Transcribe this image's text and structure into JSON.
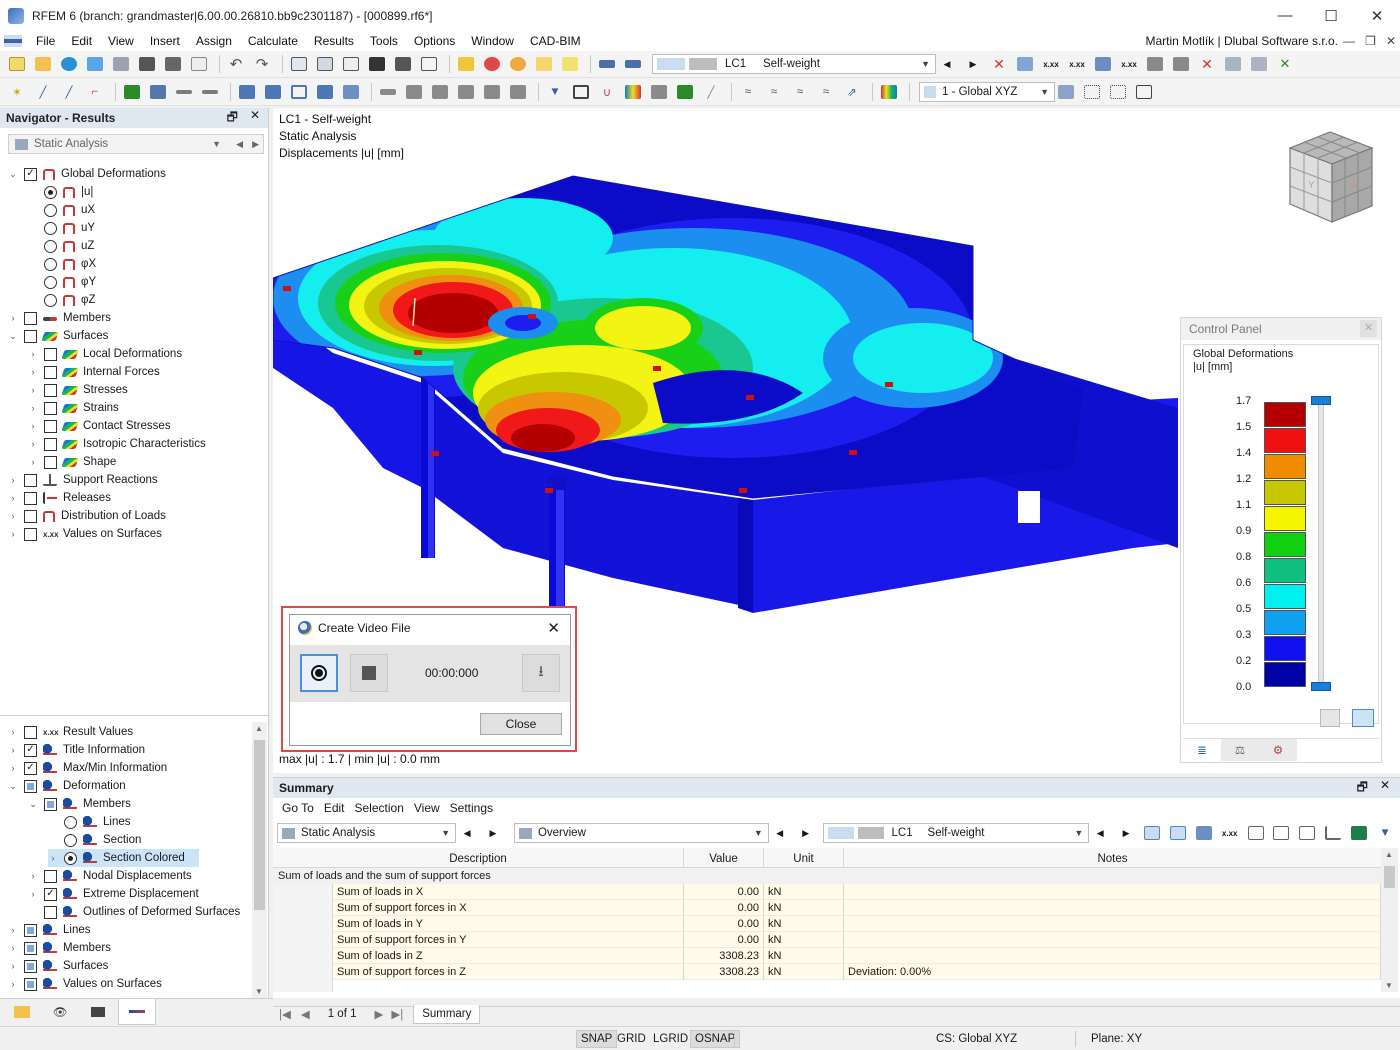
{
  "window": {
    "title": "RFEM 6 (branch: grandmaster|6.00.00.26810.bb9c2301187) - [000899.rf6*]",
    "minimize": "—",
    "maximize": "☐",
    "close": "✕"
  },
  "menu": {
    "items": [
      "File",
      "Edit",
      "View",
      "Insert",
      "Assign",
      "Calculate",
      "Results",
      "Tools",
      "Options",
      "Window",
      "CAD-BIM"
    ],
    "user": "Martin Motlík | Dlubal Software s.r.o."
  },
  "toolbar1": {
    "lc_code": "LC1",
    "lc_name": "Self-weight"
  },
  "toolbar2": {
    "coord_system": "1 - Global XYZ"
  },
  "navigator": {
    "title": "Navigator - Results",
    "selector": "Static Analysis",
    "top_tree": [
      {
        "label": "Global Deformations",
        "level": 0,
        "exp": "open",
        "check": "checked",
        "icon": "def"
      },
      {
        "label": "|u|",
        "level": 1,
        "radio": true,
        "on": true,
        "icon": "def"
      },
      {
        "label": "uX",
        "level": 1,
        "radio": true,
        "icon": "def"
      },
      {
        "label": "uY",
        "level": 1,
        "radio": true,
        "icon": "def"
      },
      {
        "label": "uZ",
        "level": 1,
        "radio": true,
        "icon": "def"
      },
      {
        "label": "φX",
        "level": 1,
        "radio": true,
        "icon": "def"
      },
      {
        "label": "φY",
        "level": 1,
        "radio": true,
        "icon": "def"
      },
      {
        "label": "φZ",
        "level": 1,
        "radio": true,
        "icon": "def"
      },
      {
        "label": "Members",
        "level": 0,
        "exp": "closed",
        "check": "empty",
        "icon": "mem"
      },
      {
        "label": "Surfaces",
        "level": 0,
        "exp": "open",
        "check": "empty",
        "icon": "surf"
      },
      {
        "label": "Local Deformations",
        "level": 1,
        "exp": "closed",
        "check": "empty",
        "icon": "surf"
      },
      {
        "label": "Internal Forces",
        "level": 1,
        "exp": "closed",
        "check": "empty",
        "icon": "surf"
      },
      {
        "label": "Stresses",
        "level": 1,
        "exp": "closed",
        "check": "empty",
        "icon": "surf"
      },
      {
        "label": "Strains",
        "level": 1,
        "exp": "closed",
        "check": "empty",
        "icon": "surf"
      },
      {
        "label": "Contact Stresses",
        "level": 1,
        "exp": "closed",
        "check": "empty",
        "icon": "surf"
      },
      {
        "label": "Isotropic Characteristics",
        "level": 1,
        "exp": "closed",
        "check": "empty",
        "icon": "surf"
      },
      {
        "label": "Shape",
        "level": 1,
        "exp": "closed",
        "check": "empty",
        "icon": "surf"
      },
      {
        "label": "Support Reactions",
        "level": 0,
        "exp": "closed",
        "check": "empty",
        "icon": "supp"
      },
      {
        "label": "Releases",
        "level": 0,
        "exp": "closed",
        "check": "empty",
        "icon": "rel"
      },
      {
        "label": "Distribution of Loads",
        "level": 0,
        "exp": "closed",
        "check": "empty",
        "icon": "def"
      },
      {
        "label": "Values on Surfaces",
        "level": 0,
        "exp": "closed",
        "check": "empty",
        "icon": "xxx"
      }
    ],
    "bottom_tree": [
      {
        "label": "Result Values",
        "level": 0,
        "exp": "closed",
        "check": "empty",
        "icon": "xxx"
      },
      {
        "label": "Title Information",
        "level": 0,
        "exp": "closed",
        "check": "checked",
        "icon": "disp"
      },
      {
        "label": "Max/Min Information",
        "level": 0,
        "exp": "closed",
        "check": "checked",
        "icon": "disp"
      },
      {
        "label": "Deformation",
        "level": 0,
        "exp": "open",
        "check": "partial",
        "icon": "disp"
      },
      {
        "label": "Members",
        "level": 1,
        "exp": "open",
        "check": "partial",
        "icon": "disp"
      },
      {
        "label": "Lines",
        "level": 2,
        "radio": true,
        "icon": "disp"
      },
      {
        "label": "Section",
        "level": 2,
        "radio": true,
        "icon": "disp"
      },
      {
        "label": "Section Colored",
        "level": 2,
        "exp": "closed",
        "radio": true,
        "on": true,
        "selected": true,
        "icon": "disp"
      },
      {
        "label": "Nodal Displacements",
        "level": 1,
        "exp": "closed",
        "check": "empty",
        "icon": "disp"
      },
      {
        "label": "Extreme Displacement",
        "level": 1,
        "exp": "closed",
        "check": "checked",
        "icon": "disp"
      },
      {
        "label": "Outlines of Deformed Surfaces",
        "level": 1,
        "check": "empty",
        "icon": "disp"
      },
      {
        "label": "Lines",
        "level": 0,
        "exp": "closed",
        "check": "partial",
        "icon": "disp"
      },
      {
        "label": "Members",
        "level": 0,
        "exp": "closed",
        "check": "partial",
        "icon": "disp"
      },
      {
        "label": "Surfaces",
        "level": 0,
        "exp": "closed",
        "check": "partial",
        "icon": "disp"
      },
      {
        "label": "Values on Surfaces",
        "level": 0,
        "exp": "closed",
        "check": "partial",
        "icon": "disp"
      }
    ]
  },
  "viewport": {
    "line1": "LC1 - Self-weight",
    "line2": "Static Analysis",
    "line3": "Displacements |u| [mm]",
    "maxmin": "max |u| : 1.7 | min |u| : 0.0 mm"
  },
  "control_panel": {
    "title": "Control Panel",
    "close": "✕",
    "heading": "Global Deformations",
    "unit": "|u| [mm]",
    "legend_values": [
      "1.7",
      "1.5",
      "1.4",
      "1.2",
      "1.1",
      "0.9",
      "0.8",
      "0.6",
      "0.5",
      "0.3",
      "0.2",
      "0.0"
    ],
    "legend_colors": [
      "#b30000",
      "#f01010",
      "#f08c00",
      "#c8c800",
      "#f5f500",
      "#10d010",
      "#10c080",
      "#00f0f0",
      "#10a0f0",
      "#1010f0",
      "#0000a8"
    ]
  },
  "video_dialog": {
    "title": "Create Video File",
    "close_x": "✕",
    "time": "00:00:000",
    "close_button": "Close"
  },
  "summary": {
    "title": "Summary",
    "menu": [
      "Go To",
      "Edit",
      "Selection",
      "View",
      "Settings"
    ],
    "analysis": "Static Analysis",
    "view": "Overview",
    "lc_code": "LC1",
    "lc_name": "Self-weight",
    "columns": [
      "Description",
      "Value",
      "Unit",
      "Notes"
    ],
    "group": "Sum of loads and the sum of support forces",
    "rows": [
      {
        "desc": "Sum of loads in X",
        "value": "0.00",
        "unit": "kN",
        "notes": ""
      },
      {
        "desc": "Sum of support forces in X",
        "value": "0.00",
        "unit": "kN",
        "notes": ""
      },
      {
        "desc": "Sum of loads in Y",
        "value": "0.00",
        "unit": "kN",
        "notes": ""
      },
      {
        "desc": "Sum of support forces in Y",
        "value": "0.00",
        "unit": "kN",
        "notes": ""
      },
      {
        "desc": "Sum of loads in Z",
        "value": "3308.23",
        "unit": "kN",
        "notes": ""
      },
      {
        "desc": "Sum of support forces in Z",
        "value": "3308.23",
        "unit": "kN",
        "notes": "Deviation: 0.00%"
      }
    ],
    "pager": "1 of 1",
    "tab": "Summary"
  },
  "statusbar": {
    "items": [
      "SNAP",
      "GRID",
      "LGRID",
      "OSNAP"
    ],
    "cs": "CS: Global XYZ",
    "plane": "Plane: XY"
  }
}
